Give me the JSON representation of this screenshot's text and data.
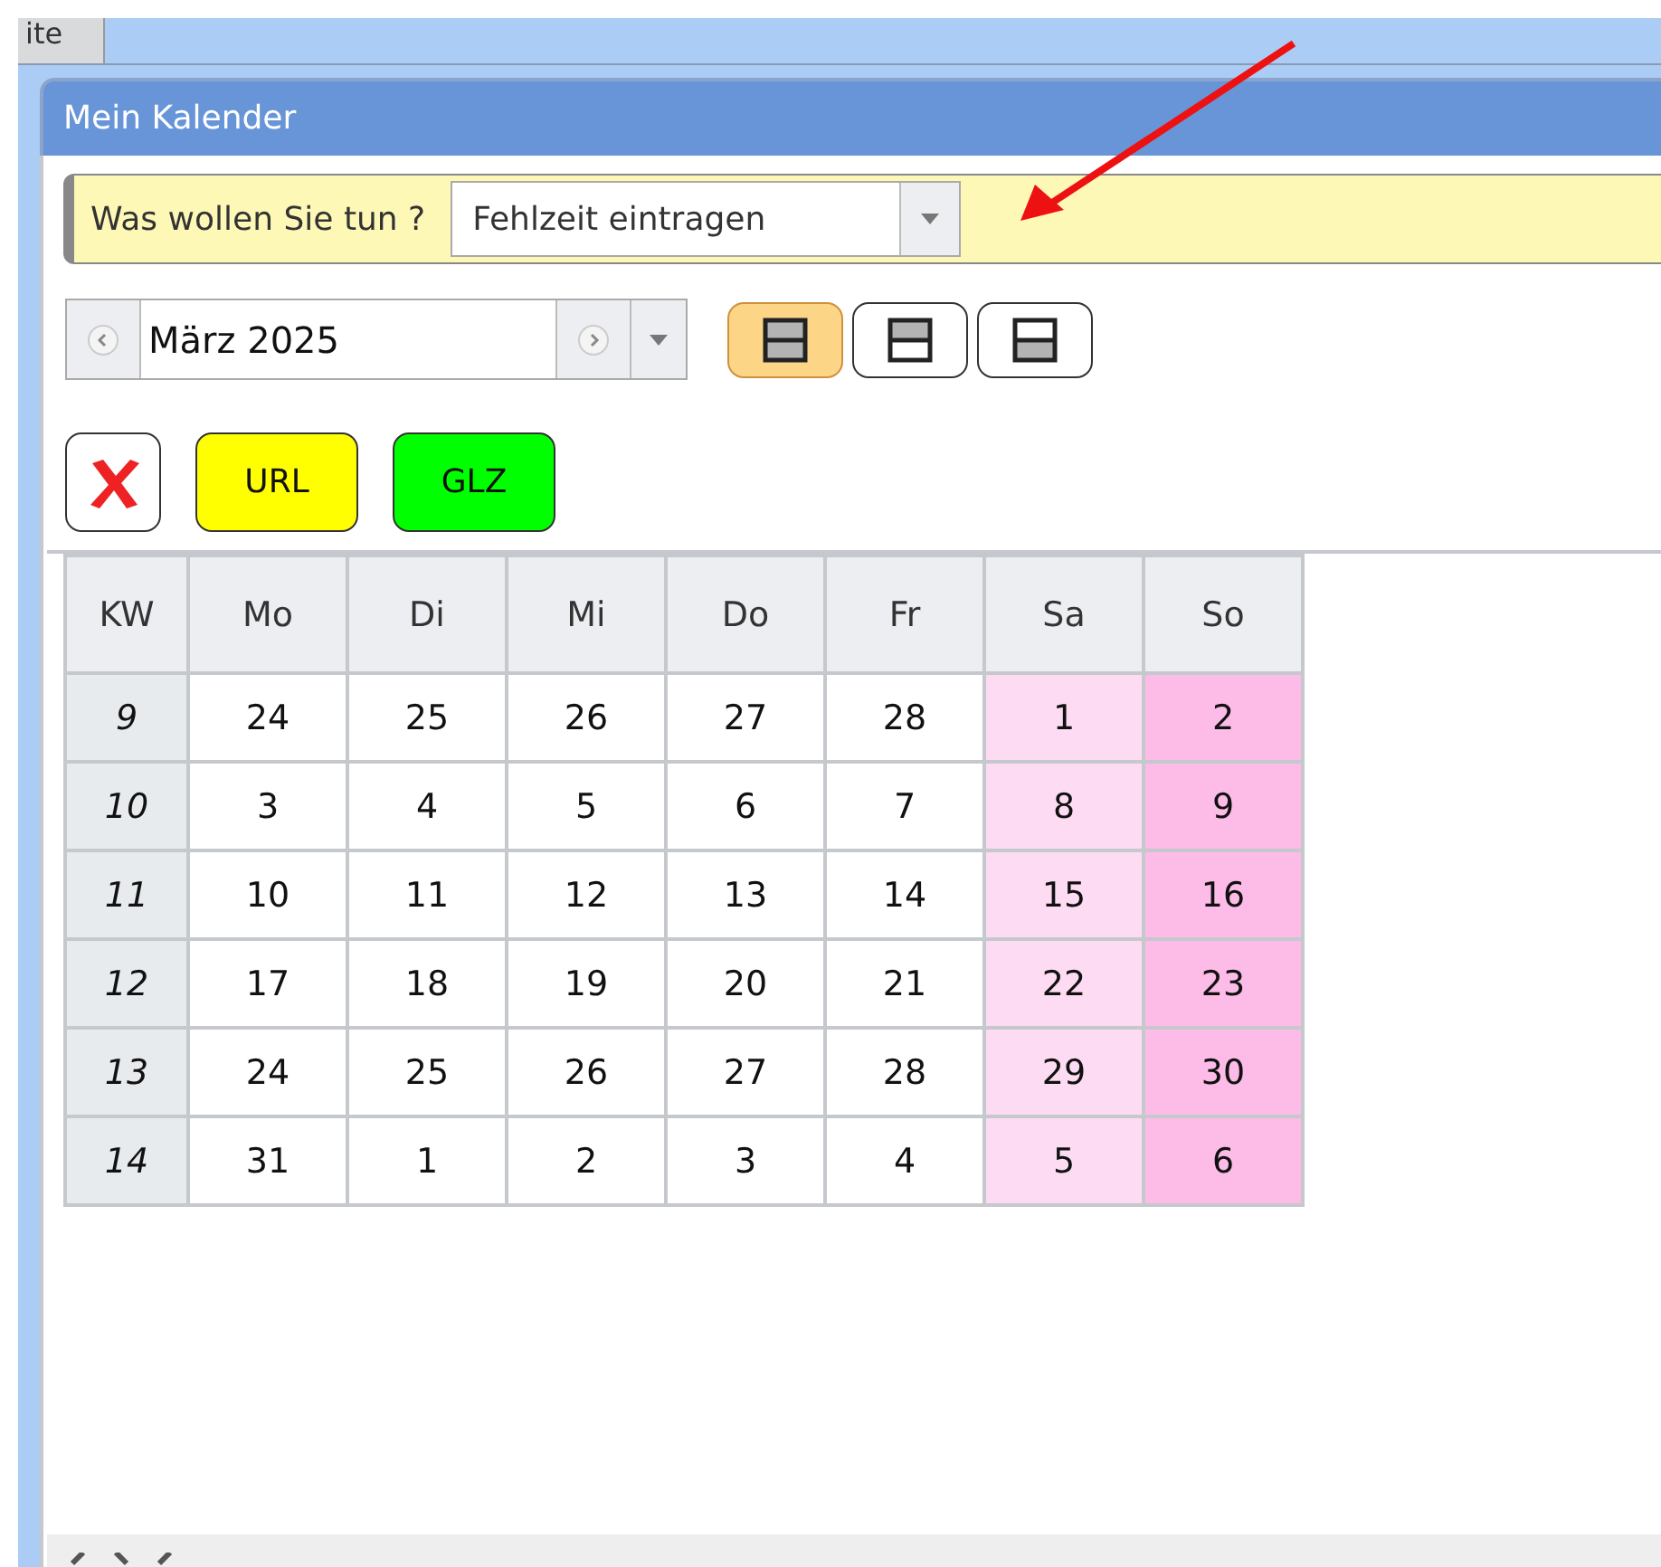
{
  "top_tab": {
    "label": "ite"
  },
  "window": {
    "title": "Mein Kalender"
  },
  "action_bar": {
    "label": "Was wollen Sie tun ?",
    "value": "Fehlzeit eintragen"
  },
  "month_picker": {
    "value": "März 2025"
  },
  "view_buttons": [
    {
      "kind": "both",
      "selected": true
    },
    {
      "kind": "top",
      "selected": false
    },
    {
      "kind": "bottom",
      "selected": false
    }
  ],
  "mark_buttons": [
    {
      "kind": "delete"
    },
    {
      "kind": "label",
      "label": "URL",
      "color": "#ffff00"
    },
    {
      "kind": "label",
      "label": "GLZ",
      "color": "#00ff00"
    }
  ],
  "calendar": {
    "columns": [
      {
        "label": "KW",
        "kind": "week"
      },
      {
        "label": "Mo",
        "kind": "day"
      },
      {
        "label": "Di",
        "kind": "day"
      },
      {
        "label": "Mi",
        "kind": "day"
      },
      {
        "label": "Do",
        "kind": "day"
      },
      {
        "label": "Fr",
        "kind": "day"
      },
      {
        "label": "Sa",
        "kind": "saturday"
      },
      {
        "label": "So",
        "kind": "sunday"
      }
    ],
    "rows": [
      {
        "week": "9",
        "days": [
          "24",
          "25",
          "26",
          "27",
          "28",
          "1",
          "2"
        ]
      },
      {
        "week": "10",
        "days": [
          "3",
          "4",
          "5",
          "6",
          "7",
          "8",
          "9"
        ]
      },
      {
        "week": "11",
        "days": [
          "10",
          "11",
          "12",
          "13",
          "14",
          "15",
          "16"
        ]
      },
      {
        "week": "12",
        "days": [
          "17",
          "18",
          "19",
          "20",
          "21",
          "22",
          "23"
        ]
      },
      {
        "week": "13",
        "days": [
          "24",
          "25",
          "26",
          "27",
          "28",
          "29",
          "30"
        ]
      },
      {
        "week": "14",
        "days": [
          "31",
          "1",
          "2",
          "3",
          "4",
          "5",
          "6"
        ]
      }
    ]
  }
}
